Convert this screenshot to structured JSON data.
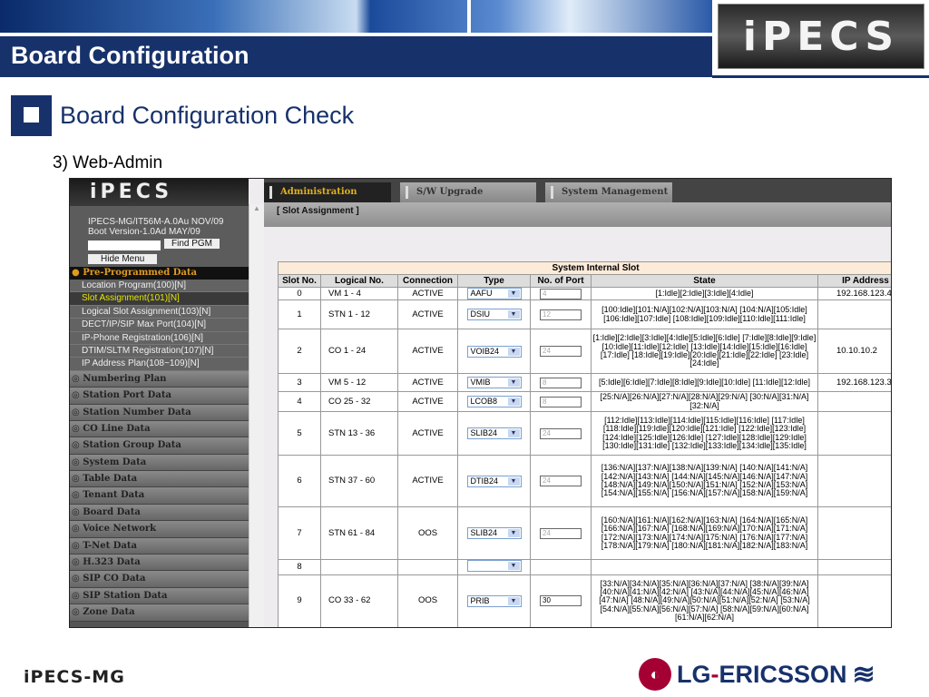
{
  "slide": {
    "title": "Board Configuration",
    "top_logo": "iPECS",
    "heading": "Board Configuration Check",
    "subheading": "3) Web-Admin",
    "footer_logo": "iPECS-MG",
    "footer_brand_lg": "LG",
    "footer_brand_sep": "-",
    "footer_brand_name": "ERICSSON",
    "accent": "#17316b"
  },
  "webadmin": {
    "logo": "iPECS",
    "version_line1": "IPECS-MG/IT56M-A.0Au NOV/09",
    "version_line2": "Boot Version-1.0Ad MAY/09",
    "find_pgm_value": "",
    "find_pgm_label": "Find PGM",
    "hide_menu_label": "Hide Menu",
    "group": "Pre-Programmed Data",
    "group_items": [
      "Location Program(100)[N]",
      "Slot Assignment(101)[N]",
      "Logical Slot Assignment(103)[N]",
      "DECT/IP/SIP Max Port(104)[N]",
      "IP-Phone Registration(106)[N]",
      "DTIM/SLTM Registration(107)[N]",
      "IP Address Plan(108~109)[N]"
    ],
    "selected_item": 1,
    "sections": [
      "Numbering Plan",
      "Station Port Data",
      "Station Number Data",
      "CO Line Data",
      "Station Group Data",
      "System Data",
      "Table Data",
      "Tenant Data",
      "Board Data",
      "Voice Network",
      "T-Net Data",
      "H.323 Data",
      "SIP CO Data",
      "SIP Station Data",
      "Zone Data"
    ],
    "tabs": [
      "Administration",
      "S/W Upgrade",
      "System Management"
    ],
    "active_tab": 0,
    "page_title": "[ Slot Assignment ]",
    "table": {
      "caption": "System Internal Slot",
      "headers": [
        "Slot No.",
        "Logical No.",
        "Connection",
        "Type",
        "No. of Port",
        "State",
        "IP Address"
      ],
      "rows": [
        {
          "slot": "0",
          "logical": "VM 1 - 4",
          "conn": "ACTIVE",
          "type": "AAFU",
          "ports": "4",
          "state": "[1:Idle][2:Idle][3:Idle][4:Idle]",
          "ip": "192.168.123.4"
        },
        {
          "slot": "1",
          "logical": "STN 1 - 12",
          "conn": "ACTIVE",
          "type": "DSIU",
          "ports": "12",
          "state": "[100:Idle][101:N/A][102:N/A][103:N/A] [104:N/A][105:Idle][106:Idle][107:Idle] [108:Idle][109:Idle][110:Idle][111:Idle]",
          "ip": ""
        },
        {
          "slot": "2",
          "logical": "CO 1 - 24",
          "conn": "ACTIVE",
          "type": "VOIB24",
          "ports": "24",
          "state": "[1:Idle][2:Idle][3:Idle][4:Idle][5:Idle][6:Idle] [7:Idle][8:Idle][9:Idle][10:Idle][11:Idle][12:Idle] [13:Idle][14:Idle][15:Idle][16:Idle][17:Idle] [18:Idle][19:Idle][20:Idle][21:Idle][22:Idle] [23:Idle][24:Idle]",
          "ip": "10.10.10.2"
        },
        {
          "slot": "3",
          "logical": "VM 5 - 12",
          "conn": "ACTIVE",
          "type": "VMIB",
          "ports": "8",
          "state": "[5:Idle][6:Idle][7:Idle][8:Idle][9:Idle][10:Idle] [11:Idle][12:Idle]",
          "ip": "192.168.123.3"
        },
        {
          "slot": "4",
          "logical": "CO 25 - 32",
          "conn": "ACTIVE",
          "type": "LCOB8",
          "ports": "8",
          "state": "[25:N/A][26:N/A][27:N/A][28:N/A][29:N/A] [30:N/A][31:N/A][32:N/A]",
          "ip": ""
        },
        {
          "slot": "5",
          "logical": "STN 13 - 36",
          "conn": "ACTIVE",
          "type": "SLIB24",
          "ports": "24",
          "state": "[112:Idle][113:Idle][114:Idle][115:Idle][116:Idle] [117:Idle][118:Idle][119:Idle][120:Idle][121:Idle] [122:Idle][123:Idle][124:Idle][125:Idle][126:Idle] [127:Idle][128:Idle][129:Idle][130:Idle][131:Idle] [132:Idle][133:Idle][134:Idle][135:Idle]",
          "ip": ""
        },
        {
          "slot": "6",
          "logical": "STN 37 - 60",
          "conn": "ACTIVE",
          "type": "DTIB24",
          "ports": "24",
          "state": "[136:N/A][137:N/A][138:N/A][139:N/A] [140:N/A][141:N/A][142:N/A][143:N/A] [144:N/A][145:N/A][146:N/A][147:N/A] [148:N/A][149:N/A][150:N/A][151:N/A] [152:N/A][153:N/A][154:N/A][155:N/A] [156:N/A][157:N/A][158:N/A][159:N/A]",
          "ip": ""
        },
        {
          "slot": "7",
          "logical": "STN 61 - 84",
          "conn": "OOS",
          "type": "SLIB24",
          "ports": "24",
          "state": "[160:N/A][161:N/A][162:N/A][163:N/A] [164:N/A][165:N/A][166:N/A][167:N/A] [168:N/A][169:N/A][170:N/A][171:N/A] [172:N/A][173:N/A][174:N/A][175:N/A] [176:N/A][177:N/A][178:N/A][179:N/A] [180:N/A][181:N/A][182:N/A][183:N/A]",
          "ip": ""
        },
        {
          "slot": "8",
          "logical": "",
          "conn": "",
          "type": "",
          "ports": null,
          "state": "",
          "ip": ""
        },
        {
          "slot": "9",
          "logical": "CO 33 - 62",
          "conn": "OOS",
          "type": "PRIB",
          "ports": "30",
          "state": "[33:N/A][34:N/A][35:N/A][36:N/A][37:N/A] [38:N/A][39:N/A][40:N/A][41:N/A][42:N/A] [43:N/A][44:N/A][45:N/A][46:N/A][47:N/A] [48:N/A][49:N/A][50:N/A][51:N/A][52:N/A] [53:N/A][54:N/A][55:N/A][56:N/A][57:N/A] [58:N/A][59:N/A][60:N/A][61:N/A][62:N/A]",
          "ip": ""
        }
      ]
    }
  }
}
